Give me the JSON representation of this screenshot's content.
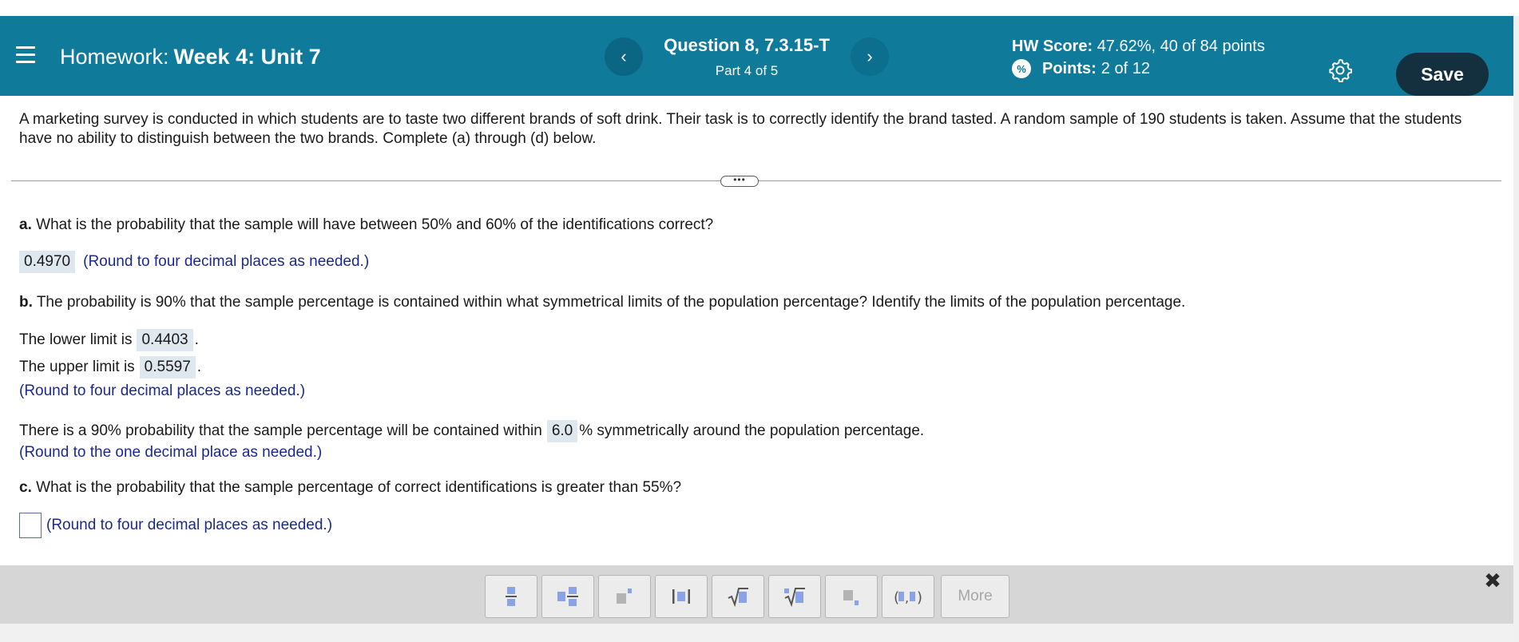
{
  "header": {
    "menu_icon": "hamburger-menu-icon",
    "hw_prefix": "Homework:",
    "hw_name": "Week 4: Unit 7",
    "question_title": "Question 8, 7.3.15-T",
    "question_part": "Part 4 of 5",
    "prev_icon": "chevron-left-icon",
    "next_icon": "chevron-right-icon",
    "hw_score_label": "HW Score:",
    "hw_score_value": "47.62%, 40 of 84 points",
    "points_label": "Points:",
    "points_value": "2 of 12",
    "settings_icon": "gear-icon",
    "save_label": "Save",
    "colors": {
      "bar": "#0f7a9a",
      "save": "#14303f"
    }
  },
  "problem": {
    "intro": "A marketing survey is conducted in which students are to taste two different brands of soft drink. Their task is to correctly identify the brand tasted. A random sample of 190 students is taken. Assume that the students have no ability to distinguish between the two brands. Complete (a) through (d) below.",
    "expand_label": "•••",
    "a": {
      "letter": "a.",
      "question": " What is the probability that the sample will have between 50% and 60% of the identifications correct?",
      "answer": "0.4970",
      "hint": "(Round to four decimal places as needed.)"
    },
    "b": {
      "letter": "b.",
      "question": " The probability is 90% that the sample percentage is contained within what symmetrical limits of the population percentage? Identify the limits of the population percentage.",
      "lower_prefix": "The lower limit is",
      "lower_value": "0.4403",
      "upper_prefix": "The upper limit is",
      "upper_value": "0.5597",
      "period": ".",
      "hint": "(Round to four decimal places as needed.)",
      "within_prefix": "There is a 90% probability that the sample percentage will be contained within",
      "within_value": "6.0",
      "within_suffix": "% symmetrically around the population percentage.",
      "within_hint": "(Round to the one decimal place as needed.)"
    },
    "c": {
      "letter": "c.",
      "question": " What is the probability that the sample percentage of correct identifications is greater than 55%?",
      "answer": "",
      "hint": "(Round to four decimal places as needed.)"
    }
  },
  "toolbar": {
    "tools": [
      "fraction-icon",
      "mixed-number-icon",
      "exponent-icon",
      "absolute-value-icon",
      "square-root-icon",
      "nth-root-icon",
      "subscript-icon",
      "ordered-pair-icon"
    ],
    "more_label": "More",
    "close_icon": "close-icon"
  }
}
